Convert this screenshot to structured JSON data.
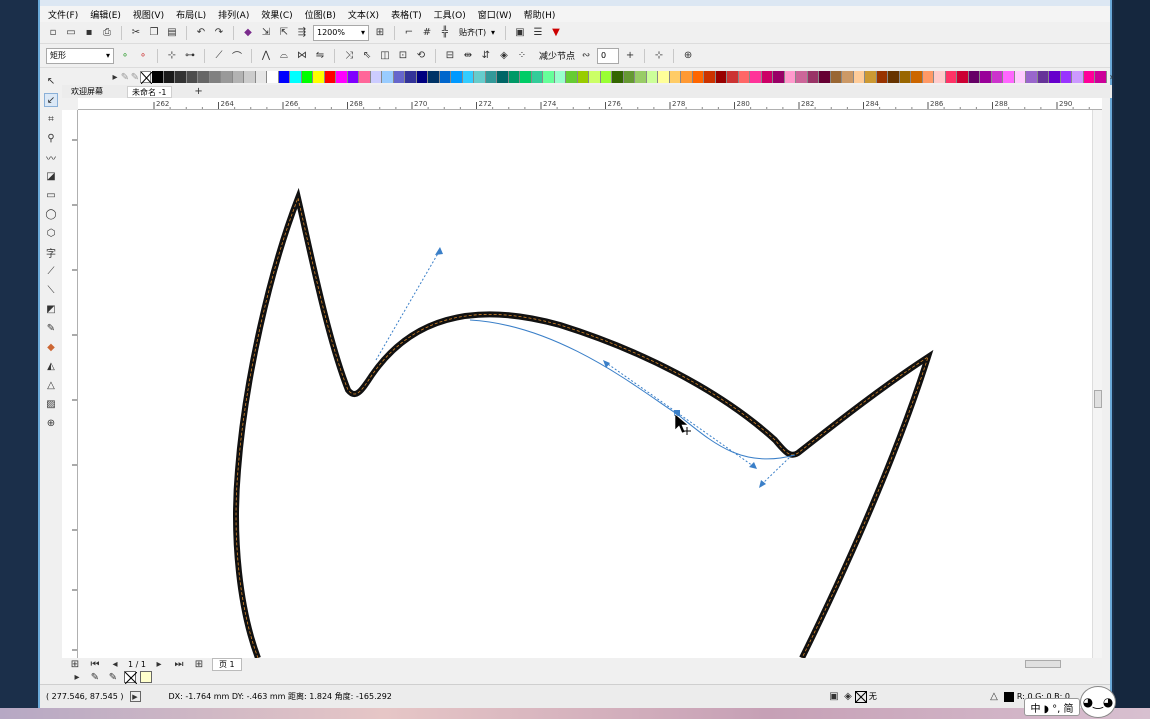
{
  "menu": [
    "文件(F)",
    "编辑(E)",
    "视图(V)",
    "布局(L)",
    "排列(A)",
    "效果(C)",
    "位图(B)",
    "文本(X)",
    "表格(T)",
    "工具(O)",
    "窗口(W)",
    "帮助(H)"
  ],
  "toolbar": {
    "zoom": "1200%",
    "snap": "贴齐(T)"
  },
  "propbar": {
    "shape_select": "矩形",
    "reduce_nodes": "减少节点",
    "smoothness": "0"
  },
  "tabs": [
    "欢迎屏幕",
    "未命名 -1"
  ],
  "ruler": {
    "h_ticks": [
      "262",
      "264",
      "266",
      "268",
      "270",
      "272",
      "274",
      "276",
      "278",
      "280",
      "282",
      "284",
      "286",
      "288",
      "290"
    ]
  },
  "palette": [
    "#000000",
    "#1a1a1a",
    "#333333",
    "#4d4d4d",
    "#666666",
    "#808080",
    "#999999",
    "#b3b3b3",
    "#cccccc",
    "#e6e6e6",
    "#ffffff",
    "#0000ff",
    "#00ffff",
    "#00ff00",
    "#ffff00",
    "#ff0000",
    "#ff00ff",
    "#8000ff",
    "#ff6699",
    "#ccccff",
    "#99ccff",
    "#6666cc",
    "#333399",
    "#000080",
    "#003366",
    "#0066cc",
    "#0099ff",
    "#33ccff",
    "#66cccc",
    "#339999",
    "#006666",
    "#009966",
    "#00cc66",
    "#33cc99",
    "#66ff99",
    "#99ffcc",
    "#66cc33",
    "#99cc00",
    "#ccff66",
    "#99ff33",
    "#336600",
    "#669933",
    "#99cc66",
    "#ccff99",
    "#ffff99",
    "#ffcc66",
    "#ff9933",
    "#ff6600",
    "#cc3300",
    "#990000",
    "#cc3333",
    "#ff6666",
    "#ff3399",
    "#cc0066",
    "#990066",
    "#ff99cc",
    "#cc6699",
    "#993366",
    "#660033",
    "#996633",
    "#cc9966",
    "#ffcc99",
    "#cc9933",
    "#993300",
    "#663300",
    "#996600",
    "#cc6600",
    "#ff9966",
    "#ffcccc",
    "#ff3366",
    "#cc0033",
    "#660066",
    "#990099",
    "#cc33cc",
    "#ff66ff",
    "#ffccff",
    "#9966cc",
    "#663399",
    "#6600cc",
    "#9933ff",
    "#cc99ff",
    "#ff0099",
    "#cc0099"
  ],
  "pagebar": {
    "page_counter": "1 / 1",
    "page_tab": "页 1"
  },
  "status": {
    "coords": "( 277.546, 87.545 )",
    "delta": "DX: -1.764 mm DY: -.463 mm 距离: 1.824 角度: -165.292",
    "fill_none": "无",
    "outline_color": "R: 0 G: 0 B: 0"
  },
  "ime": {
    "label": "中 ◗ °, 简"
  }
}
